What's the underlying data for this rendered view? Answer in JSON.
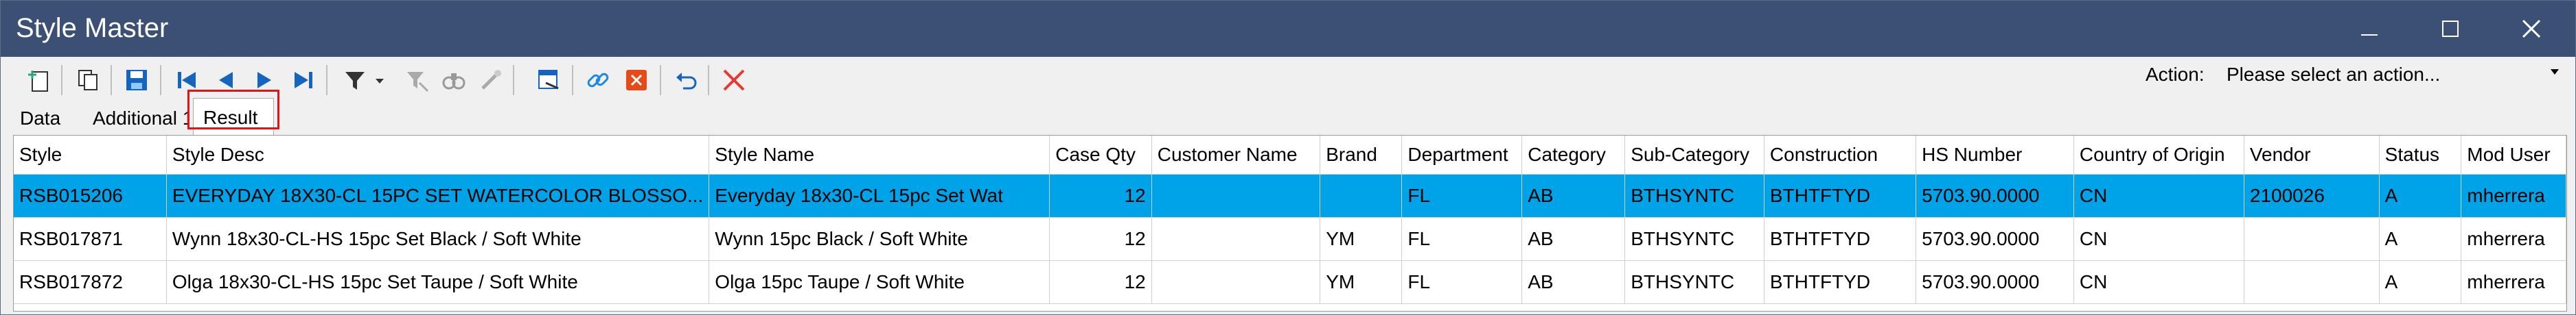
{
  "window": {
    "title": "Style Master"
  },
  "toolbar": {
    "icons": [
      "new-icon",
      "copy-icon",
      "save-icon",
      "first-record-icon",
      "previous-record-icon",
      "next-record-icon",
      "last-record-icon",
      "filter-icon",
      "clear-filter-icon",
      "find-icon",
      "tools-icon",
      "export-icon",
      "link-icon",
      "delete-icon",
      "undo-icon",
      "cancel-icon"
    ]
  },
  "action": {
    "label": "Action:",
    "value": "Please select an action..."
  },
  "tabs": [
    {
      "label": "Data"
    },
    {
      "label": "Additional 1"
    },
    {
      "label": "Result",
      "active": true
    }
  ],
  "grid": {
    "columns": [
      "Style",
      "Style Desc",
      "Style Name",
      "Case Qty",
      "Customer Name",
      "Brand",
      "Department",
      "Category",
      "Sub-Category",
      "Construction",
      "HS Number",
      "Country of Origin",
      "Vendor",
      "Status",
      "Mod User"
    ],
    "rows": [
      {
        "selected": true,
        "cells": [
          "RSB015206",
          "EVERYDAY 18X30-CL 15PC SET WATERCOLOR BLOSSO...",
          "Everyday 18x30-CL 15pc Set Wat",
          "12",
          "",
          "",
          "FL",
          "AB",
          "BTHSYNTC",
          "BTHTFTYD",
          "5703.90.0000",
          "CN",
          "2100026",
          "A",
          "mherrera"
        ]
      },
      {
        "selected": false,
        "cells": [
          "RSB017871",
          "Wynn 18x30-CL-HS 15pc Set Black / Soft White",
          "Wynn 15pc Black / Soft White",
          "12",
          "",
          "YM",
          "FL",
          "AB",
          "BTHSYNTC",
          "BTHTFTYD",
          "5703.90.0000",
          "CN",
          "",
          "A",
          "mherrera"
        ]
      },
      {
        "selected": false,
        "cells": [
          "RSB017872",
          "Olga 18x30-CL-HS 15pc Set Taupe / Soft White",
          "Olga 15pc Taupe / Soft White",
          "12",
          "",
          "YM",
          "FL",
          "AB",
          "BTHSYNTC",
          "BTHTFTYD",
          "5703.90.0000",
          "CN",
          "",
          "A",
          "mherrera"
        ]
      }
    ]
  },
  "colors": {
    "titlebar": "#3c5075",
    "selection": "#00a2e8",
    "highlight": "#e01515"
  }
}
